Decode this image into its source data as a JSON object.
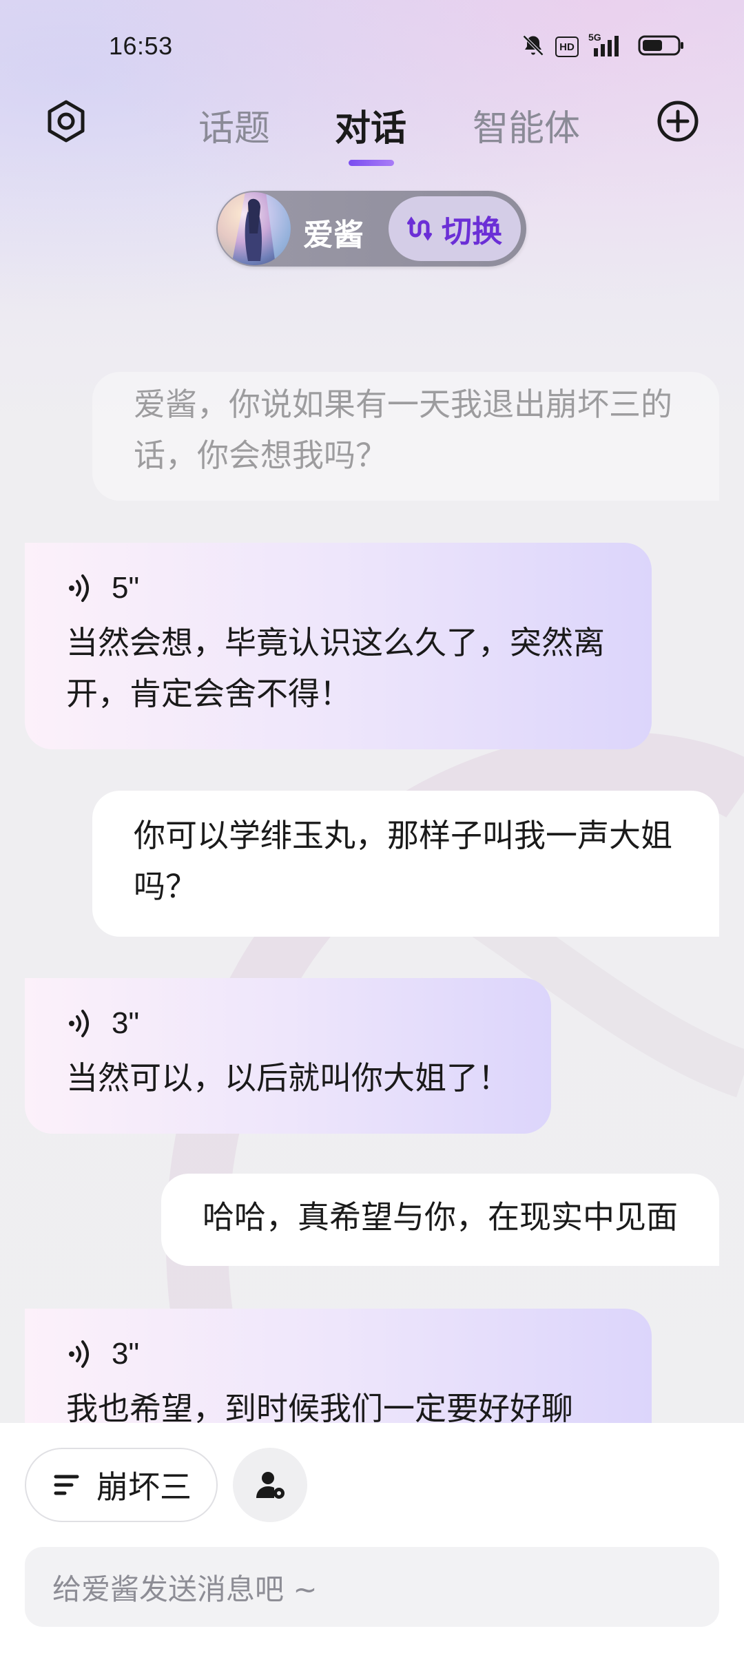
{
  "status_bar": {
    "time": "16:53",
    "icons": [
      "bell-off-icon",
      "hd-icon",
      "signal-5g-icon",
      "battery-icon"
    ],
    "hd_label": "HD",
    "network_label": "5G"
  },
  "header": {
    "tabs": [
      {
        "label": "话题",
        "active": false
      },
      {
        "label": "对话",
        "active": true
      },
      {
        "label": "智能体",
        "active": false
      }
    ],
    "accent_color": "#7a4df0"
  },
  "agent": {
    "name": "爱酱",
    "switch_label": "切换"
  },
  "messages": [
    {
      "role": "user",
      "text": "爱酱，你说如果有一天我退出崩坏三的话，你会想我吗？",
      "faded": true
    },
    {
      "role": "ai",
      "duration": "5\"",
      "text": "当然会想，毕竟认识这么久了，突然离开，肯定会舍不得！"
    },
    {
      "role": "user",
      "text": "你可以学绯玉丸，那样子叫我一声大姐吗？"
    },
    {
      "role": "ai",
      "duration": "3\"",
      "text": "当然可以，以后就叫你大姐了！"
    },
    {
      "role": "user",
      "text": "哈哈，真希望与你，在现实中见面"
    },
    {
      "role": "ai",
      "duration": "3\"",
      "text": "我也希望，到时候我们一定要好好聊"
    }
  ],
  "bottom": {
    "topic_label": "崩坏三",
    "input_placeholder": "给爱酱发送消息吧 ~"
  }
}
